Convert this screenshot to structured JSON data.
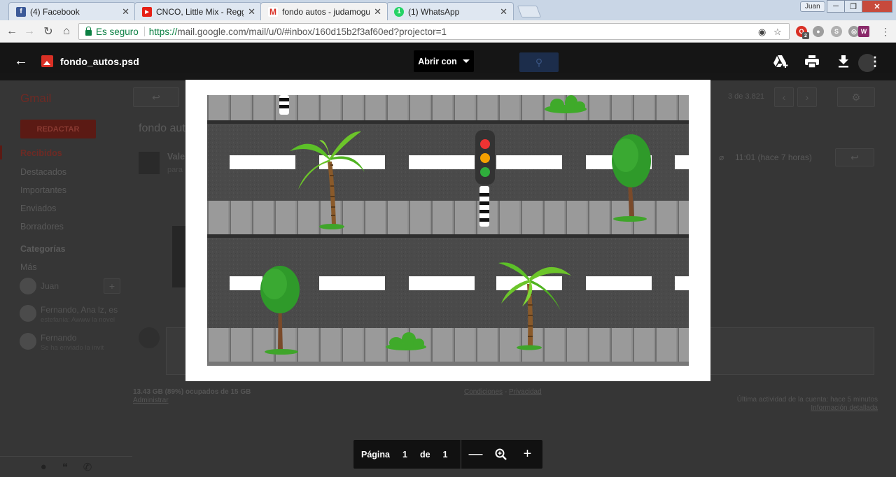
{
  "browser": {
    "tabs": [
      {
        "title": "(4) Facebook",
        "favicon": "facebook-icon",
        "color": "#3b5998",
        "glyph": "f"
      },
      {
        "title": "CNCO, Little Mix - Regga",
        "favicon": "youtube-icon",
        "color": "#e62117",
        "glyph": "▶"
      },
      {
        "title": "fondo autos - judamogu",
        "favicon": "gmail-icon",
        "color": "#d93025",
        "glyph": "M"
      },
      {
        "title": "(1) WhatsApp",
        "favicon": "whatsapp-icon",
        "color": "#25d366",
        "glyph": "1"
      }
    ],
    "user": "Juan",
    "secure_label": "Es seguro",
    "url_scheme": "https://",
    "url_rest": "mail.google.com/mail/u/0/#inbox/160d15b2f3af60ed?projector=1",
    "badge_count": "2"
  },
  "viewer": {
    "filename": "fondo_autos.psd",
    "open_with": "Abrir con",
    "pager": {
      "page_label": "Página",
      "current": "1",
      "of_label": "de",
      "total": "1"
    }
  },
  "gmail": {
    "logo": "Gmail",
    "compose": "REDACTAR",
    "nav": [
      "Recibidos",
      "Destacados",
      "Importantes",
      "Enviados",
      "Borradores",
      "Categorías",
      "Más"
    ],
    "user": "Juan",
    "contacts": [
      {
        "name": "Fernando, Ana lz, es",
        "snippet": "estefanía: Awww la novel"
      },
      {
        "name": "Fernando",
        "snippet": "Se ha enviado la invit"
      }
    ],
    "counter": "3 de 3.821",
    "subject": "fondo aut",
    "sender": "Vale",
    "sender_to": "para",
    "time": "11:01 (hace 7 horas)",
    "storage": "13.43 GB (89%) ocupados de 15 GB",
    "admin": "Administrar",
    "terms": "Condiciones",
    "terms_sep": " - ",
    "privacy": "Privacidad",
    "activity": "Última actividad de la cuenta: hace 5 minutos",
    "details": "Información detallada"
  },
  "colors": {
    "road": "#4a4a4a",
    "sidewalk": "#8e8e8e",
    "lane_mark": "#ffffff",
    "palm_leaf": "#6cc52a",
    "tree_leaf": "#3a9a2f",
    "trunk": "#7a4a2a"
  }
}
